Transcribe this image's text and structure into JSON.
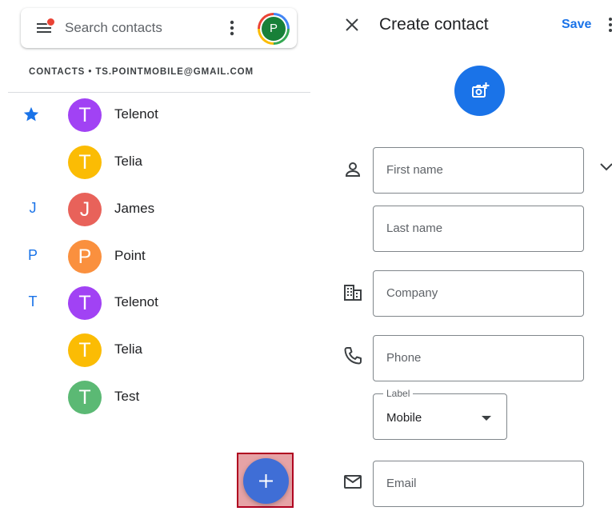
{
  "search": {
    "placeholder": "Search contacts"
  },
  "account": {
    "initial": "P",
    "label": "CONTACTS • TS.POINTMOBILE@GMAIL.COM"
  },
  "contacts": [
    {
      "index": "",
      "starred": true,
      "initial": "T",
      "name": "Telenot",
      "color": "#a142f4"
    },
    {
      "index": "",
      "starred": false,
      "initial": "T",
      "name": "Telia",
      "color": "#fbbc04"
    },
    {
      "index": "J",
      "starred": false,
      "initial": "J",
      "name": "James",
      "color": "#e8625a"
    },
    {
      "index": "P",
      "starred": false,
      "initial": "P",
      "name": "Point",
      "color": "#fa903e"
    },
    {
      "index": "T",
      "starred": false,
      "initial": "T",
      "name": "Telenot",
      "color": "#a142f4"
    },
    {
      "index": "",
      "starred": false,
      "initial": "T",
      "name": "Telia",
      "color": "#fbbc04"
    },
    {
      "index": "",
      "starred": false,
      "initial": "T",
      "name": "Test",
      "color": "#5bb974"
    }
  ],
  "form": {
    "title": "Create contact",
    "save_label": "Save",
    "first_name": "First name",
    "last_name": "Last name",
    "company": "Company",
    "phone": "Phone",
    "label_caption": "Label",
    "label_value": "Mobile",
    "email": "Email"
  },
  "colors": {
    "accent": "#1a73e8",
    "fab": "#3f6ed6",
    "highlight_border": "#b00020"
  }
}
